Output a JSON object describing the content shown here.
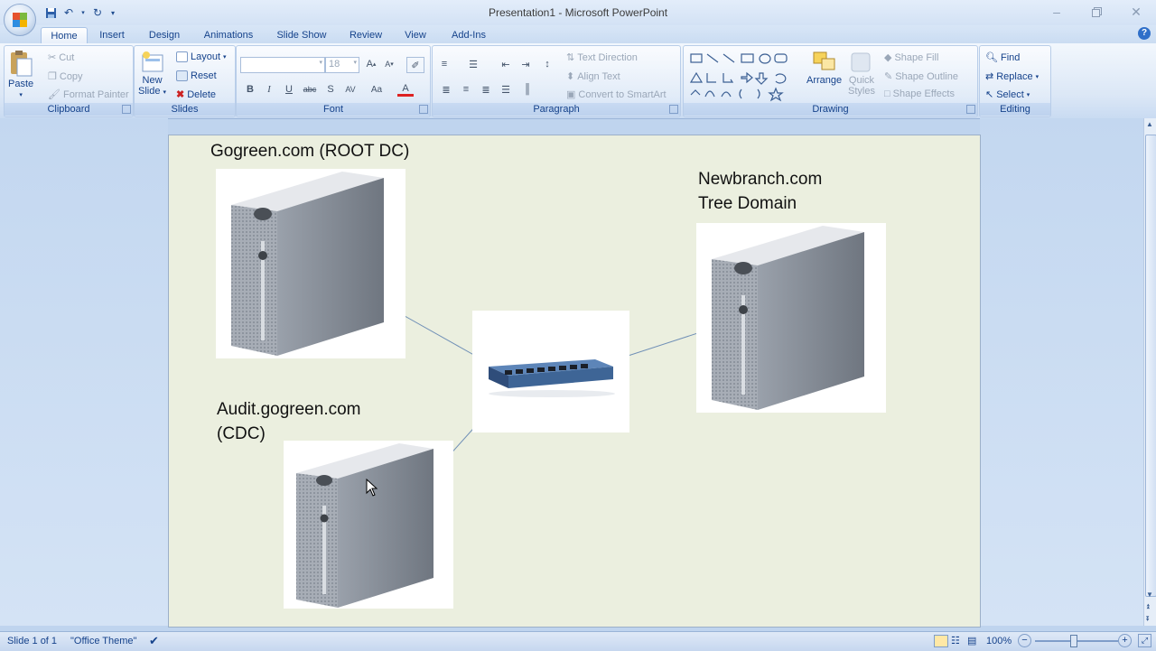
{
  "window": {
    "title": "Presentation1 - Microsoft PowerPoint",
    "quick_access": [
      "save-icon",
      "undo-icon",
      "redo-icon",
      "customize-icon"
    ]
  },
  "tabs": [
    {
      "label": "Home",
      "active": true
    },
    {
      "label": "Insert"
    },
    {
      "label": "Design"
    },
    {
      "label": "Animations"
    },
    {
      "label": "Slide Show"
    },
    {
      "label": "Review"
    },
    {
      "label": "View"
    },
    {
      "label": "Add-Ins"
    }
  ],
  "ribbon": {
    "clipboard": {
      "label": "Clipboard",
      "paste": "Paste",
      "cut": "Cut",
      "copy": "Copy",
      "format_painter": "Format Painter"
    },
    "slides": {
      "label": "Slides",
      "new_slide_line1": "New",
      "new_slide_line2": "Slide",
      "layout": "Layout",
      "reset": "Reset",
      "delete": "Delete"
    },
    "font": {
      "label": "Font",
      "font_name": "",
      "font_size": "18"
    },
    "paragraph": {
      "label": "Paragraph",
      "text_direction": "Text Direction",
      "align_text": "Align Text",
      "convert_smartart": "Convert to SmartArt"
    },
    "drawing": {
      "label": "Drawing",
      "arrange": "Arrange",
      "quick_styles_line1": "Quick",
      "quick_styles_line2": "Styles",
      "shape_fill": "Shape Fill",
      "shape_outline": "Shape Outline",
      "shape_effects": "Shape Effects"
    },
    "editing": {
      "label": "Editing",
      "find": "Find",
      "replace": "Replace",
      "select": "Select"
    }
  },
  "slide": {
    "root_label": "Gogreen.com (ROOT DC)",
    "tree_label_line1": "Newbranch.com",
    "tree_label_line2": "Tree Domain",
    "child_label_line1": "Audit.gogreen.com",
    "child_label_line2": "(CDC)"
  },
  "status": {
    "slide_info": "Slide 1 of 1",
    "theme": "\"Office Theme\"",
    "zoom": "100%"
  },
  "colors": {
    "ribbon_text": "#15428b",
    "slide_bg": "#ebefdf",
    "workspace": "#c3d7f0"
  }
}
